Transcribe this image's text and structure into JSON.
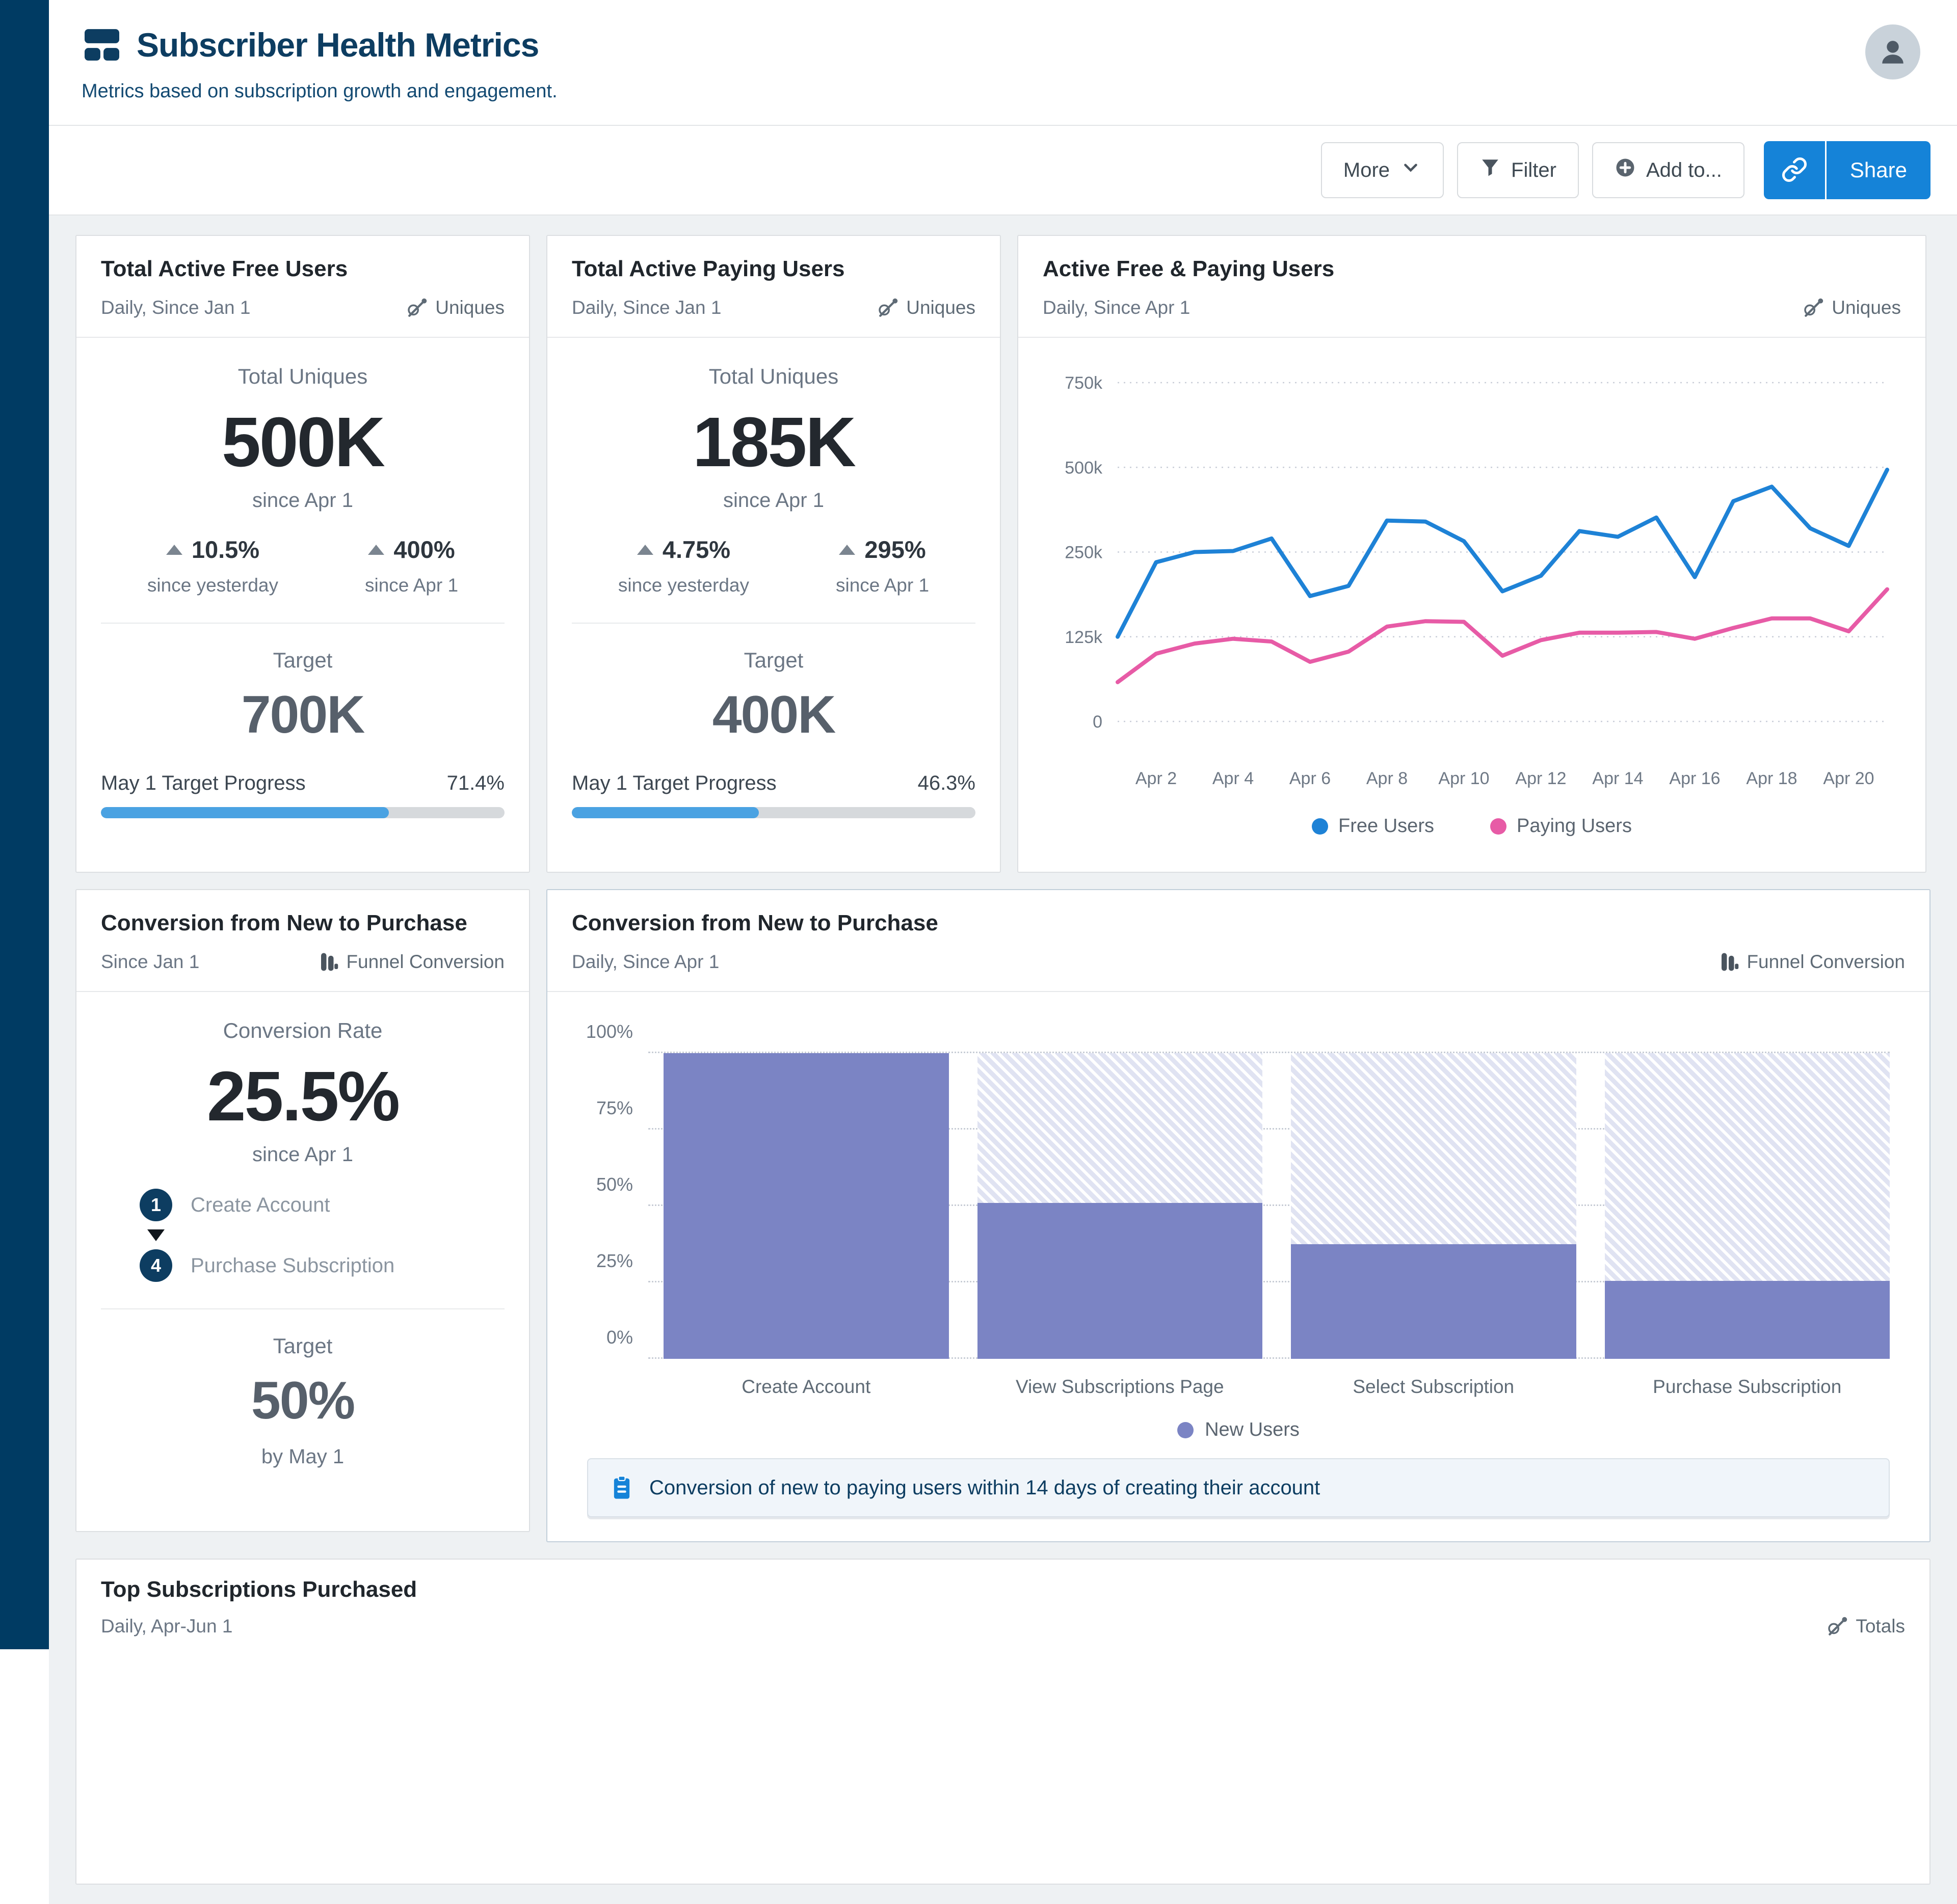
{
  "header": {
    "title": "Subscriber Health Metrics",
    "subtitle": "Metrics based on subscription growth and engagement."
  },
  "toolbar": {
    "more_label": "More",
    "filter_label": "Filter",
    "add_to_label": "Add to...",
    "share_label": "Share"
  },
  "colors": {
    "accent_blue": "#1583d8",
    "progress_blue": "#4aa2e2",
    "navy": "#0d3d61",
    "sidebar_navy": "#003b63",
    "funnel_purple": "#7b84c4",
    "funnel_stripe": "#e0e3f2",
    "free_line": "#1e82d6",
    "paying_line": "#e75ba6"
  },
  "cards": {
    "free_users": {
      "title": "Total Active Free Users",
      "period": "Daily, Since Jan 1",
      "mode": "Uniques",
      "metric_label": "Total Uniques",
      "value": "500K",
      "since": "since Apr 1",
      "delta1": "10.5%",
      "delta1_caption": "since yesterday",
      "delta2": "400%",
      "delta2_caption": "since Apr 1",
      "target_label": "Target",
      "target_value": "700K",
      "progress_label": "May 1 Target Progress",
      "progress_value": "71.4%",
      "progress_pct": 71.4
    },
    "paying_users": {
      "title": "Total Active Paying Users",
      "period": "Daily, Since Jan 1",
      "mode": "Uniques",
      "metric_label": "Total Uniques",
      "value": "185K",
      "since": "since Apr 1",
      "delta1": "4.75%",
      "delta1_caption": "since yesterday",
      "delta2": "295%",
      "delta2_caption": "since Apr 1",
      "target_label": "Target",
      "target_value": "400K",
      "progress_label": "May 1 Target Progress",
      "progress_value": "46.3%",
      "progress_pct": 46.3
    },
    "funnel_summary": {
      "title": "Conversion from New to Purchase",
      "period": "Since Jan 1",
      "mode": "Funnel Conversion",
      "metric_label": "Conversion Rate",
      "value": "25.5%",
      "since": "since Apr 1",
      "step1_num": "1",
      "step1_label": "Create Account",
      "step2_num": "4",
      "step2_label": "Purchase Subscription",
      "target_label": "Target",
      "target_value": "50%",
      "target_caption": "by May 1"
    },
    "top_subscriptions": {
      "title": "Top Subscriptions Purchased",
      "period": "Daily, Apr-Jun 1",
      "mode": "Totals"
    }
  },
  "chart_data": [
    {
      "type": "line",
      "title": "Active Free & Paying Users",
      "period": "Daily, Since Apr 1",
      "mode": "Uniques",
      "dates": [
        "Apr 1",
        "Apr 2",
        "Apr 3",
        "Apr 4",
        "Apr 5",
        "Apr 6",
        "Apr 7",
        "Apr 8",
        "Apr 9",
        "Apr 10",
        "Apr 11",
        "Apr 12",
        "Apr 13",
        "Apr 14",
        "Apr 15",
        "Apr 16",
        "Apr 17",
        "Apr 18",
        "Apr 19",
        "Apr 20",
        "Apr 21"
      ],
      "x_tick_labels": [
        "Apr 2",
        "Apr 4",
        "Apr 6",
        "Apr 8",
        "Apr 10",
        "Apr 12",
        "Apr 14",
        "Apr 16",
        "Apr 18",
        "Apr 20"
      ],
      "ytick_values_k": [
        0,
        125,
        250,
        500,
        750
      ],
      "ytick_labels": [
        "0",
        "125k",
        "250k",
        "500k",
        "750k"
      ],
      "grid": "dotted-horizontal",
      "legend_position": "bottom",
      "series": [
        {
          "name": "Free Users",
          "color": "#1e82d6",
          "values_k": [
            125,
            235,
            250,
            253,
            290,
            185,
            200,
            343,
            340,
            282,
            192,
            215,
            312,
            295,
            352,
            213,
            400,
            443,
            320,
            268,
            493
          ]
        },
        {
          "name": "Paying Users",
          "color": "#e75ba6",
          "values_k": [
            58,
            100,
            115,
            122,
            118,
            88,
            103,
            140,
            148,
            147,
            97,
            120,
            131,
            131,
            132,
            122,
            138,
            152,
            152,
            133,
            195
          ]
        }
      ]
    },
    {
      "type": "bar",
      "subtype": "funnel",
      "title": "Conversion from New to Purchase",
      "period": "Daily, Since Apr 1",
      "mode": "Funnel Conversion",
      "categories": [
        "Create Account",
        "View Subscriptions Page",
        "Select Subscription",
        "Purchase Subscription"
      ],
      "values": [
        100,
        51,
        37.5,
        25.5
      ],
      "ylim": [
        0,
        100
      ],
      "yticks": [
        "0%",
        "25%",
        "50%",
        "75%",
        "100%"
      ],
      "grid": "dotted-horizontal",
      "series_name": "New Users",
      "bar_color": "#7b84c4",
      "note": "Conversion of new to paying users within 14 days of creating their account"
    }
  ]
}
